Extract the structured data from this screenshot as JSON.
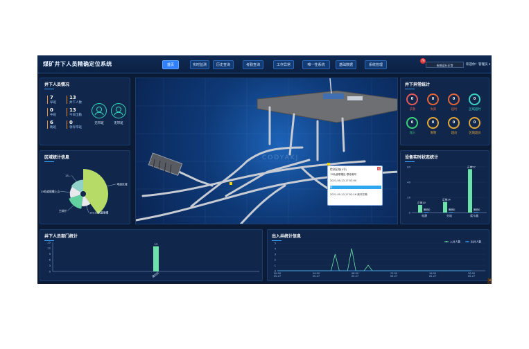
{
  "header": {
    "title": "煤矿井下人员精确定位系统",
    "tabs": [
      "首页",
      "实时监测",
      "历史查询",
      "考勤查询",
      "工作异常",
      "唯一性系统",
      "基础数据",
      "系统管理"
    ],
    "active_tab": 0,
    "alarm_count": "76",
    "status": "系统运行正常",
    "greeting": "欢迎你!",
    "user": "管理员"
  },
  "personnel": {
    "title": "井下人员情况",
    "stats": [
      {
        "value": "7",
        "label": "早班"
      },
      {
        "value": "13",
        "label": "井下人数"
      },
      {
        "value": "0",
        "label": "中班"
      },
      {
        "value": "13",
        "label": "今日出勤"
      },
      {
        "value": "6",
        "label": "晚班"
      },
      {
        "value": "0",
        "label": "领导带班"
      }
    ],
    "icons": [
      {
        "label": "无带班"
      },
      {
        "label": "无带班"
      }
    ]
  },
  "abnormal": {
    "title": "井下异常统计",
    "items": [
      {
        "value": "0",
        "label": "求救",
        "color": "#e25a5a"
      },
      {
        "value": "0",
        "label": "失踪",
        "color": "#e2653a"
      },
      {
        "value": "0",
        "label": "超时",
        "color": "#e2653a"
      },
      {
        "value": "0",
        "label": "区域超时",
        "color": "#3ad3c0"
      },
      {
        "value": "0",
        "label": "闯入",
        "color": "#3ad37a"
      },
      {
        "value": "0",
        "label": "限制",
        "color": "#e2a83a"
      },
      {
        "value": "0",
        "label": "超员",
        "color": "#e2a83a"
      },
      {
        "value": "0",
        "label": "区域超员",
        "color": "#e2a83a"
      }
    ]
  },
  "area_stats": {
    "title": "区域统计信息",
    "chart_data": {
      "type": "pie",
      "labels": [
        "地面区域",
        "15111轨道顺槽",
        "主斜井",
        "15轨道顺槽上山",
        "15..."
      ],
      "values": [
        40,
        12,
        18,
        14,
        16
      ]
    }
  },
  "device_stats": {
    "title": "设备实时状态统计",
    "chart_data": {
      "type": "bar",
      "categories": [
        "电源",
        "分站",
        "读卡器"
      ],
      "series": [
        {
          "name": "正常",
          "values": [
            10,
            14,
            57
          ]
        },
        {
          "name": "断线",
          "values": [
            0,
            0,
            0
          ]
        }
      ],
      "ylim": [
        0,
        60
      ],
      "yticks": [
        0,
        20,
        40,
        60
      ],
      "labels": [
        "正常10",
        "断线0",
        "正常14",
        "断线0",
        "正常57",
        "断线0"
      ]
    }
  },
  "dept_stats": {
    "title": "井下人员部门统计",
    "chart_data": {
      "type": "bar",
      "categories": [
        "通风科"
      ],
      "values": [
        13
      ],
      "ylim": [
        0,
        15
      ],
      "yticks": [
        0,
        3,
        6,
        9,
        12,
        15
      ],
      "data_label": "13"
    }
  },
  "shaft_stats": {
    "title": "出入井统计信息",
    "chart_data": {
      "type": "line",
      "legend": [
        "入井人数",
        "出井人数"
      ],
      "x": [
        "00:00\n05-27",
        "04:00\n05-27",
        "08:00\n05-27",
        "12:00\n05-27",
        "16:00\n05-27",
        "20:00\n05-27"
      ],
      "ylim": [
        0,
        5
      ],
      "yticks": [
        0,
        1,
        2,
        3,
        4,
        5
      ],
      "series": [
        {
          "name": "入井人数",
          "values": [
            0,
            0,
            0,
            0,
            0,
            0,
            0,
            0,
            0,
            0,
            0,
            0,
            0,
            0,
            3,
            0,
            0,
            0,
            4,
            0,
            0,
            0,
            1,
            0,
            0,
            0,
            0,
            0,
            0,
            0,
            0,
            0,
            0,
            0,
            0,
            0,
            0,
            0,
            0,
            0,
            0,
            0,
            0,
            0,
            0,
            0,
            0,
            0
          ]
        },
        {
          "name": "出井人数",
          "values": [
            0,
            0,
            0,
            0,
            0,
            0,
            0,
            0,
            0,
            0,
            0,
            0,
            0,
            0,
            0,
            0,
            0,
            0,
            0,
            0,
            0,
            0,
            0,
            0,
            0,
            0,
            0,
            0,
            0,
            0,
            0,
            0,
            0,
            0,
            0,
            0,
            0,
            0,
            0,
            0,
            0,
            0,
            0,
            0,
            0,
            0,
            0,
            0
          ]
        }
      ]
    }
  },
  "map": {
    "watermark": "CODYAKJ",
    "popup": {
      "header": "检测区域(4号)",
      "rows": [
        "15轨道顺槽区-联络巷号",
        "2021-05-13 17:52:00",
        "区",
        "2021-05-13 17:52:16 离开井筒"
      ]
    }
  },
  "colors": {
    "accent": "#2f80ff",
    "green": "#6be3a8",
    "teal": "#3ad3c0"
  }
}
